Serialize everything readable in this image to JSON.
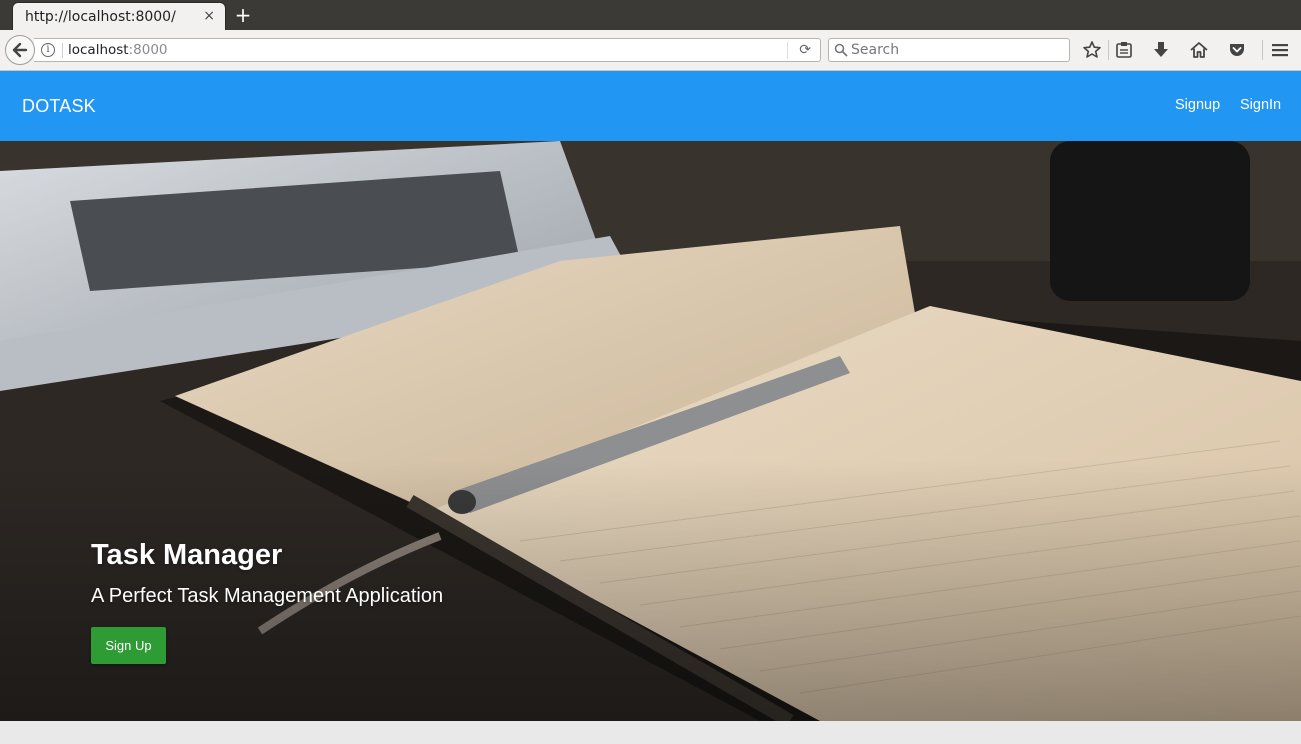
{
  "browser": {
    "tab_title": "http://localhost:8000/",
    "tab_close": "×",
    "new_tab": "+",
    "url_host": "localhost",
    "url_port": ":8000",
    "search_placeholder": "Search"
  },
  "navbar": {
    "brand": "DOTASK",
    "links": [
      {
        "label": "Signup"
      },
      {
        "label": "SignIn"
      }
    ],
    "color": "#2196f3"
  },
  "hero": {
    "title": "Task Manager",
    "subtitle": "A Perfect Task Management Application",
    "button_label": "Sign Up",
    "button_color": "#2e9b35"
  }
}
